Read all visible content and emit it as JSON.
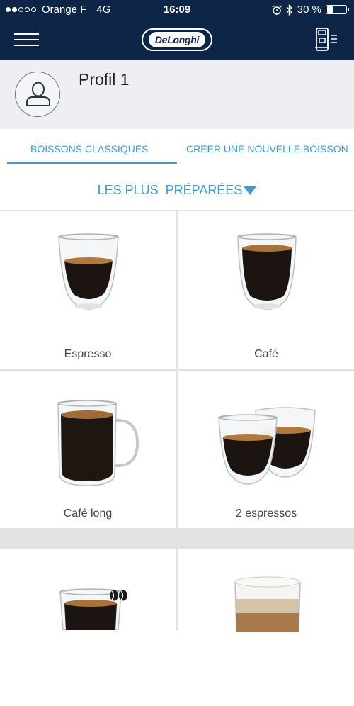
{
  "status_bar": {
    "carrier": "Orange F",
    "network": "4G",
    "time": "16:09",
    "battery": "30 %",
    "battery_level_percent": 30,
    "signal_bars_full": 2,
    "signal_bars_total": 5
  },
  "header": {
    "brand": "DeLonghi",
    "brand_color": "#0d2547"
  },
  "profile": {
    "name": "Profil 1"
  },
  "tabs": [
    {
      "label": "BOISSONS CLASSIQUES",
      "active": true
    },
    {
      "label": "CREER UNE NOUVELLE BOISSON",
      "active": false
    }
  ],
  "filter": {
    "label": "LES PLUS  PRÉPARÉES"
  },
  "drinks": [
    {
      "label": "Espresso",
      "icon": "espresso-glass"
    },
    {
      "label": "Café",
      "icon": "coffee-glass"
    },
    {
      "label": "Café long",
      "icon": "long-coffee-mug"
    },
    {
      "label": "2 espressos",
      "icon": "double-espresso-glasses"
    },
    {
      "label": "",
      "icon": "doppio-glass"
    },
    {
      "label": "",
      "icon": "latte-macchiato-glass"
    }
  ],
  "accent_color": "#3a9bd5"
}
